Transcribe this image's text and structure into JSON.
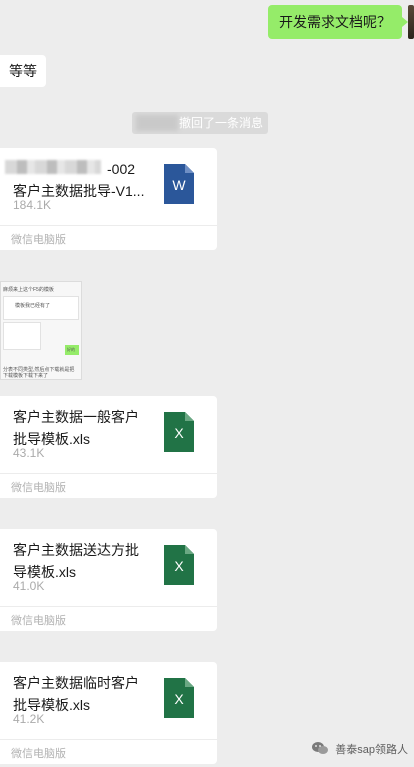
{
  "messages": {
    "outgoing_text": "开发需求文档呢？",
    "incoming_text": "等等",
    "recall_notice": "撤回了一条消息"
  },
  "files": [
    {
      "title_line1": "-002",
      "title_line2": "客户主数据批导-V1...",
      "size": "184.1K",
      "source": "微信电脑版",
      "icon": "word-file-icon",
      "glyph": "W"
    },
    {
      "title_line1": "客户主数据一般客户",
      "title_line2": "批导模板.xls",
      "size": "43.1K",
      "source": "微信电脑版",
      "icon": "excel-file-icon",
      "glyph": "X"
    },
    {
      "title_line1": "客户主数据送达方批",
      "title_line2": "导模板.xls",
      "size": "41.0K",
      "source": "微信电脑版",
      "icon": "excel-file-icon",
      "glyph": "X"
    },
    {
      "title_line1": "客户主数据临时客户",
      "title_line2": "批导模板.xls",
      "size": "41.2K",
      "source": "微信电脑版",
      "icon": "excel-file-icon",
      "glyph": "X"
    }
  ],
  "thumbnail": {
    "line1": "麻烦来上这个F5的模板",
    "line2": "模板我已经有了",
    "line3": "好的",
    "line4": "分表不同类型,然后点下载就是把",
    "line5": "下载模板下载下来了"
  },
  "watermark": "善泰sap领路人",
  "colors": {
    "green_bubble": "#95ec69",
    "word_blue": "#2b579a",
    "excel_green": "#217346",
    "background": "#ededed"
  }
}
